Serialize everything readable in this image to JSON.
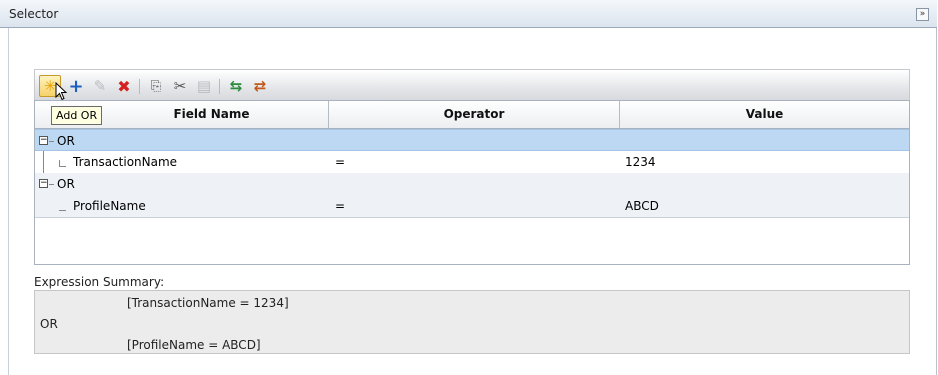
{
  "panel": {
    "title": "Selector",
    "collapse_glyph": "»"
  },
  "toolbar": {
    "buttons": [
      {
        "name": "add-or-icon",
        "glyph": "✳"
      },
      {
        "name": "add-icon",
        "glyph": "+"
      },
      {
        "name": "edit-icon",
        "glyph": "✎"
      },
      {
        "name": "delete-icon",
        "glyph": "✖"
      },
      {
        "name": "copy-icon",
        "glyph": "⎘"
      },
      {
        "name": "cut-icon",
        "glyph": "✂"
      },
      {
        "name": "paste-icon",
        "glyph": "▤"
      },
      {
        "name": "import-icon",
        "glyph": "⇆"
      },
      {
        "name": "export-icon",
        "glyph": "⇄"
      }
    ],
    "tooltip": "Add OR"
  },
  "grid": {
    "columns": [
      "Field Name",
      "Operator",
      "Value"
    ],
    "rows": [
      {
        "type": "group",
        "field": "OR",
        "operator": "",
        "value": ""
      },
      {
        "type": "leaf",
        "field": "TransactionName",
        "operator": "=",
        "value": "1234"
      },
      {
        "type": "group",
        "field": "OR",
        "operator": "",
        "value": ""
      },
      {
        "type": "leaf",
        "field": "ProfileName",
        "operator": "=",
        "value": "ABCD"
      }
    ]
  },
  "summary": {
    "label": "Expression Summary:",
    "lines": [
      "[TransactionName = 1234]",
      "OR",
      "[ProfileName = ABCD]"
    ]
  },
  "colors": {
    "selected_row": "#bcd8f3",
    "delete_red": "#d42020",
    "add_blue": "#1f5fbf"
  }
}
